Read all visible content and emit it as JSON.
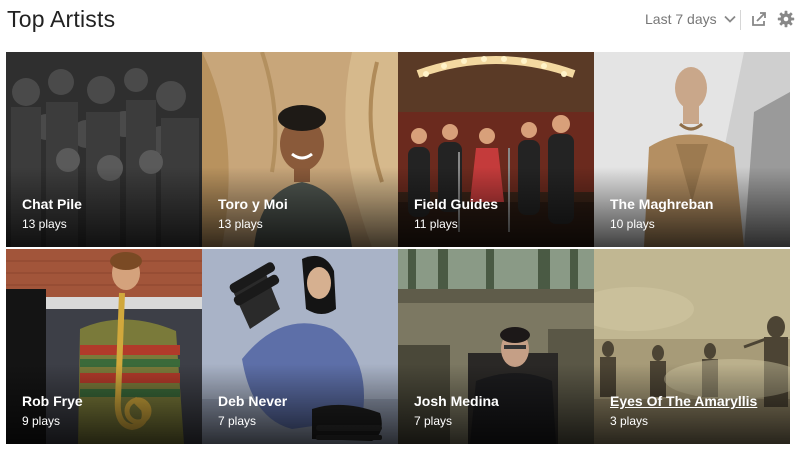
{
  "header": {
    "title": "Top Artists",
    "range_label": "Last 7 days"
  },
  "icons": {
    "range": "chevron-down-icon",
    "share": "share-icon",
    "settings": "gear-icon"
  },
  "artists": [
    {
      "name": "Chat Pile",
      "plays": "13 plays"
    },
    {
      "name": "Toro y Moi",
      "plays": "13 plays"
    },
    {
      "name": "Field Guides",
      "plays": "11 plays"
    },
    {
      "name": "The Maghreban",
      "plays": "10 plays"
    },
    {
      "name": "Rob Frye",
      "plays": "9 plays"
    },
    {
      "name": "Deb Never",
      "plays": "7 plays"
    },
    {
      "name": "Josh Medina",
      "plays": "7 plays"
    },
    {
      "name": "Eyes Of The Amaryllis",
      "plays": "3 plays"
    }
  ]
}
